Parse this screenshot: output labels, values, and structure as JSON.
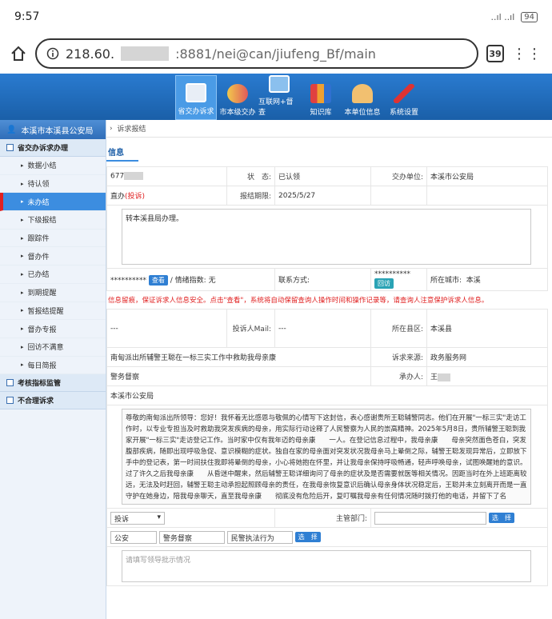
{
  "status_bar": {
    "time": "9:57",
    "signal": "..ıl ..ıl",
    "battery": "94"
  },
  "browser": {
    "url_host": "218.60.",
    "url_port_path": ":8881/nei@can/jiufeng_Bf/main",
    "tab_count": "39"
  },
  "nav": [
    {
      "label": "省交办诉求",
      "icon": "monitor-icon",
      "active": true
    },
    {
      "label": "市本级交办",
      "icon": "people-icon"
    },
    {
      "label": "互联网+督查",
      "icon": "document-icon"
    },
    {
      "label": "知识库",
      "icon": "books-icon"
    },
    {
      "label": "本单位信息",
      "icon": "user-icon"
    },
    {
      "label": "系统设置",
      "icon": "tools-icon"
    }
  ],
  "sidebar": {
    "title": "本溪市本溪县公安局",
    "group1": "省交办诉求办理",
    "items": [
      "数据小结",
      "待认领",
      "未办结",
      "下级报结",
      "跟踪件",
      "督办件",
      "已办结",
      "到期提醒",
      "暂报结提醒",
      "督办专报",
      "回访不满意",
      "每日简报"
    ],
    "group2": "考核指标监管",
    "group3": "不合理诉求"
  },
  "breadcrumb": {
    "sep": "›",
    "current": "诉求报结"
  },
  "section_title": "信息",
  "form": {
    "id_value": "677",
    "status_label": "状　态:",
    "status_value": "已认领",
    "unit_label": "交办单位:",
    "unit_value": "本溪市公安局",
    "type_value": "直办",
    "type_tag": "(投诉)",
    "deadline_label": "报结期限:",
    "deadline_value": "2025/5/27",
    "instruction": "转本溪县局办理。",
    "masked": "**********",
    "view_btn": "查看",
    "emotion_label": "/ 情绪指数:",
    "emotion_value": "无",
    "contact_label": "联系方式:",
    "contact_masked": "**********",
    "callback_btn": "回访",
    "city_label": "所在城市:",
    "city_value": "本溪",
    "warning": "信息留痕，保证诉求人信息安全。点击\"查看\"，系统将自动保留查询人操作时间和操作记录等，请查询人注意保护诉求人信息。",
    "dash1": "---",
    "mail_label": "投诉人Mail:",
    "dash2": "---",
    "county_label": "所在县区:",
    "county_value": "本溪县",
    "subject": "南甸派出所辅警王聪在一标三实工作中救助我母亲康",
    "source_label": "诉求来源:",
    "source_value": "政务服务网",
    "category": "警务督察",
    "handler_label": "承办人:",
    "handler_value": "王",
    "dept": "本溪市公安局",
    "content": "尊敬的南甸派出所领导：您好！我怀着无比感恩与敬佩的心情写下这封信，表心感谢贵所王聪辅警同志。他们在开展\"一标三实\"走访工作时，以专业专担当及时救助我突发疾病的母亲，用实际行动诠释了人民警察为人民的崇高精神。2025年5月8日，贵所辅警王聪到我家开展\"一标三实\"走访登记工作。当时家中仅有我年迈的母亲康　　一人。在登记信息过程中，我母亲康　　母亲突然面色苍白，突发腹部疾病，随即出现呼吸急促、意识模糊的症状。独自在家的母亲面对突发状况我母亲马上晕倒之际，辅警王聪发现异常后，立即放下手中的登记表，第一时间扶住我即将晕倒的母亲，小心将她抱在怀里，并让我母亲保持呼吸畅通，轻声呼唤母亲，试图唤醒她的意识。过了许久之后我母亲康　　从昏迷中醒来，然后辅警王聪详细询问了母亲的症状及是否需要就医等相关情况。因距当时在外上班距离较远，无法及时赶回，辅警王聪主动承担起照顾母亲的责任，在我母亲恢复意识后确认母亲身体状况稳定后，王聪并未立刻离开而是一直守护在她身边，陪我母亲聊天，直至我母亲康　　彻底没有危险后开，复叮嘱我母亲有任何情况随时拨打他的电话，并留下了名",
    "complaint_select": "投诉",
    "supervisor_label": "主管部门:",
    "select_btn": "选　择",
    "tag1": "公安",
    "tag2": "警务督察",
    "tag3": "民警执法行为",
    "select_btn2": "选　择",
    "placeholder": "请填写领导批示情况"
  }
}
